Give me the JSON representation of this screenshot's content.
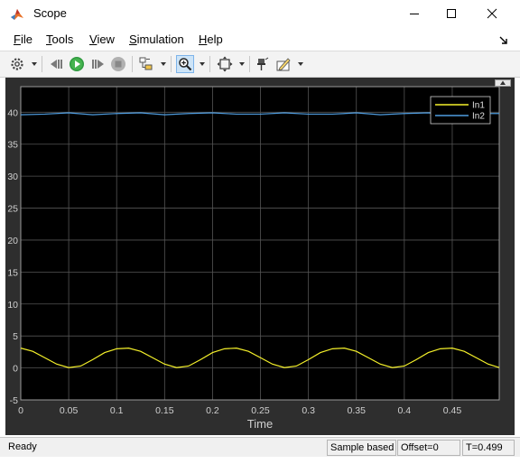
{
  "window": {
    "title": "Scope",
    "minimize": "–",
    "maximize": "☐",
    "close": "✕"
  },
  "menu": {
    "items": [
      {
        "label": "File",
        "underline": "F",
        "rest": "ile"
      },
      {
        "label": "Tools",
        "underline": "T",
        "rest": "ools"
      },
      {
        "label": "View",
        "underline": "V",
        "rest": "iew"
      },
      {
        "label": "Simulation",
        "underline": "S",
        "rest": "imulation"
      },
      {
        "label": "Help",
        "underline": "H",
        "rest": "elp"
      }
    ]
  },
  "toolbar": {
    "icons": [
      "settings-icon",
      "step-back-icon",
      "run-icon",
      "step-forward-icon",
      "stop-icon",
      "highlight-block-icon",
      "zoom-icon",
      "fit-icon",
      "pin-icon",
      "edit-icon"
    ]
  },
  "colors": {
    "axes_bg": "#000000",
    "figure_bg": "#2e2e2e",
    "grid": "#555555",
    "tick": "#d0d0d0",
    "in1": "#f5f12a",
    "in2": "#4f9de0"
  },
  "chart_data": {
    "type": "line",
    "xlabel": "Time",
    "ylabel": "",
    "xlim": [
      0,
      0.499
    ],
    "ylim": [
      -5,
      44
    ],
    "xticks": [
      "0",
      "0.05",
      "0.1",
      "0.15",
      "0.2",
      "0.25",
      "0.3",
      "0.35",
      "0.4",
      "0.45"
    ],
    "yticks": [
      "-5",
      "0",
      "5",
      "10",
      "15",
      "20",
      "25",
      "30",
      "35",
      "40"
    ],
    "grid": true,
    "legend": "top-right",
    "series": [
      {
        "name": "In1",
        "color": "#f5f12a",
        "x": [
          0,
          0.0125,
          0.025,
          0.0375,
          0.05,
          0.0625,
          0.075,
          0.0875,
          0.1,
          0.1125,
          0.125,
          0.1375,
          0.15,
          0.1625,
          0.175,
          0.1875,
          0.2,
          0.2125,
          0.225,
          0.2375,
          0.25,
          0.2625,
          0.275,
          0.2875,
          0.3,
          0.3125,
          0.325,
          0.3375,
          0.35,
          0.3625,
          0.375,
          0.3875,
          0.4,
          0.4125,
          0.425,
          0.4375,
          0.45,
          0.4625,
          0.475,
          0.4875,
          0.499
        ],
        "values": [
          3.1,
          2.6,
          1.6,
          0.6,
          0.05,
          0.3,
          1.3,
          2.4,
          3.0,
          3.1,
          2.6,
          1.6,
          0.6,
          0.05,
          0.3,
          1.3,
          2.4,
          3.0,
          3.1,
          2.6,
          1.6,
          0.6,
          0.05,
          0.3,
          1.3,
          2.4,
          3.0,
          3.1,
          2.6,
          1.6,
          0.6,
          0.05,
          0.3,
          1.3,
          2.4,
          3.0,
          3.1,
          2.6,
          1.6,
          0.6,
          0.05
        ]
      },
      {
        "name": "In2",
        "color": "#4f9de0",
        "x": [
          0,
          0.025,
          0.05,
          0.075,
          0.1,
          0.125,
          0.15,
          0.175,
          0.2,
          0.225,
          0.25,
          0.275,
          0.3,
          0.325,
          0.35,
          0.375,
          0.4,
          0.425,
          0.45,
          0.475,
          0.499
        ],
        "values": [
          39.6,
          39.7,
          39.9,
          39.6,
          39.8,
          39.9,
          39.6,
          39.8,
          39.9,
          39.7,
          39.7,
          39.9,
          39.7,
          39.7,
          39.9,
          39.6,
          39.8,
          39.9,
          39.6,
          39.8,
          39.8
        ]
      }
    ]
  },
  "status": {
    "text": "Ready",
    "mode": "Sample based",
    "offset": "Offset=0",
    "time": "T=0.499"
  }
}
